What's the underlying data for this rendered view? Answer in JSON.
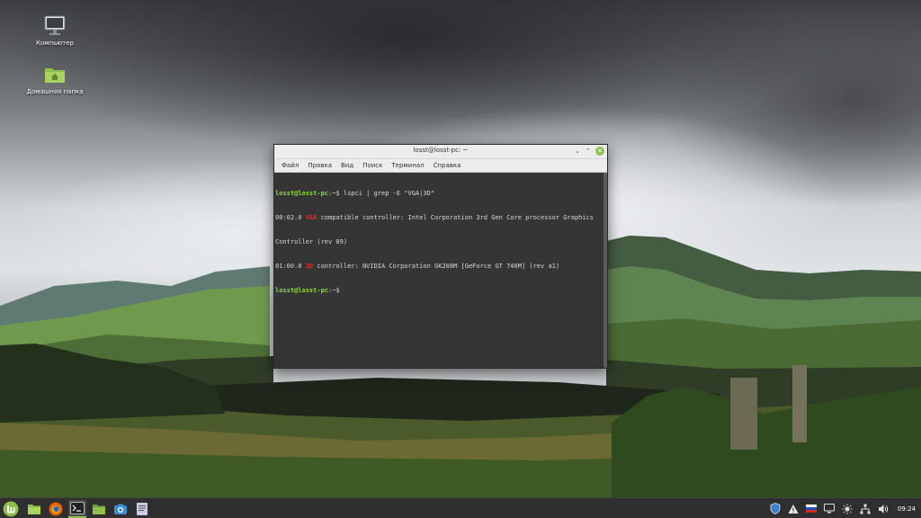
{
  "desktop": {
    "icons": [
      {
        "label": "Компьютер",
        "icon": "monitor-icon"
      },
      {
        "label": "Домашняя папка",
        "icon": "home-folder-icon"
      }
    ]
  },
  "terminal": {
    "title": "losst@losst-pc: ~",
    "menu": [
      "Файл",
      "Правка",
      "Вид",
      "Поиск",
      "Терминал",
      "Справка"
    ],
    "lines": [
      {
        "prompt": "losst@losst-pc",
        "sep": ":~$ ",
        "command": "lspci | grep -E \"VGA|3D\""
      },
      {
        "pre": "00:02.0 ",
        "match": "VGA",
        "post": " compatible controller: Intel Corporation 3rd Gen Core processor Graphics"
      },
      {
        "text": "Controller (rev 09)"
      },
      {
        "pre": "01:00.0 ",
        "match": "3D",
        "post": " controller: NVIDIA Corporation GK208M [GeForce GT 740M] (rev a1)"
      },
      {
        "prompt": "losst@losst-pc",
        "sep": ":~$",
        "command": ""
      }
    ]
  },
  "taskbar": {
    "launcher_icon": "mint-menu-icon",
    "apps": [
      {
        "name": "show-desktop-icon",
        "color": "#8fbf4d"
      },
      {
        "name": "firefox-icon",
        "color": "#e66000"
      },
      {
        "name": "terminal-icon",
        "color": "#222222",
        "active": true
      },
      {
        "name": "files-icon",
        "color": "#8fbf4d"
      },
      {
        "name": "screenshot-icon",
        "color": "#3d8fd6"
      },
      {
        "name": "text-editor-icon",
        "color": "#c9c9e8"
      }
    ],
    "tray": [
      "shield-icon",
      "warning-icon",
      "keyboard-layout-icon",
      "display-icon",
      "brightness-icon",
      "network-icon",
      "volume-icon"
    ],
    "clock": "09:24"
  },
  "colors": {
    "accent": "#8fbf4d",
    "prompt": "#8ae234",
    "match": "#ef2929",
    "terminal_bg": "#353535"
  }
}
